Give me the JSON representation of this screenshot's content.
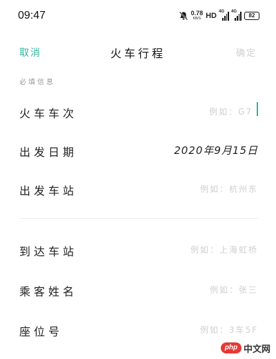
{
  "status_bar": {
    "time": "09:47",
    "speed_value": "0.78",
    "speed_unit": "KB/S",
    "hd": "HD",
    "signal_1_tag": "4G",
    "signal_2_tag": "4G",
    "battery": "82"
  },
  "header": {
    "cancel_label": "取消",
    "title": "火车行程",
    "confirm_label": "确定"
  },
  "section_label": "必填信息",
  "fields": [
    {
      "label": "火车车次",
      "value": "例如：G7"
    },
    {
      "label": "出发日期",
      "value": "2020年9月15日"
    },
    {
      "label": "出发车站",
      "value": "例如：杭州东"
    },
    {
      "label": "到达车站",
      "value": "例如：上海虹桥"
    },
    {
      "label": "乘客姓名",
      "value": "例如：张三"
    },
    {
      "label": "座位号",
      "value": "例如：3车5F"
    }
  ],
  "watermark": {
    "logo": "php",
    "site": "中文网"
  },
  "colors": {
    "accent": "#2fb3a0",
    "placeholder": "#cfcfcf",
    "text": "#222222"
  }
}
